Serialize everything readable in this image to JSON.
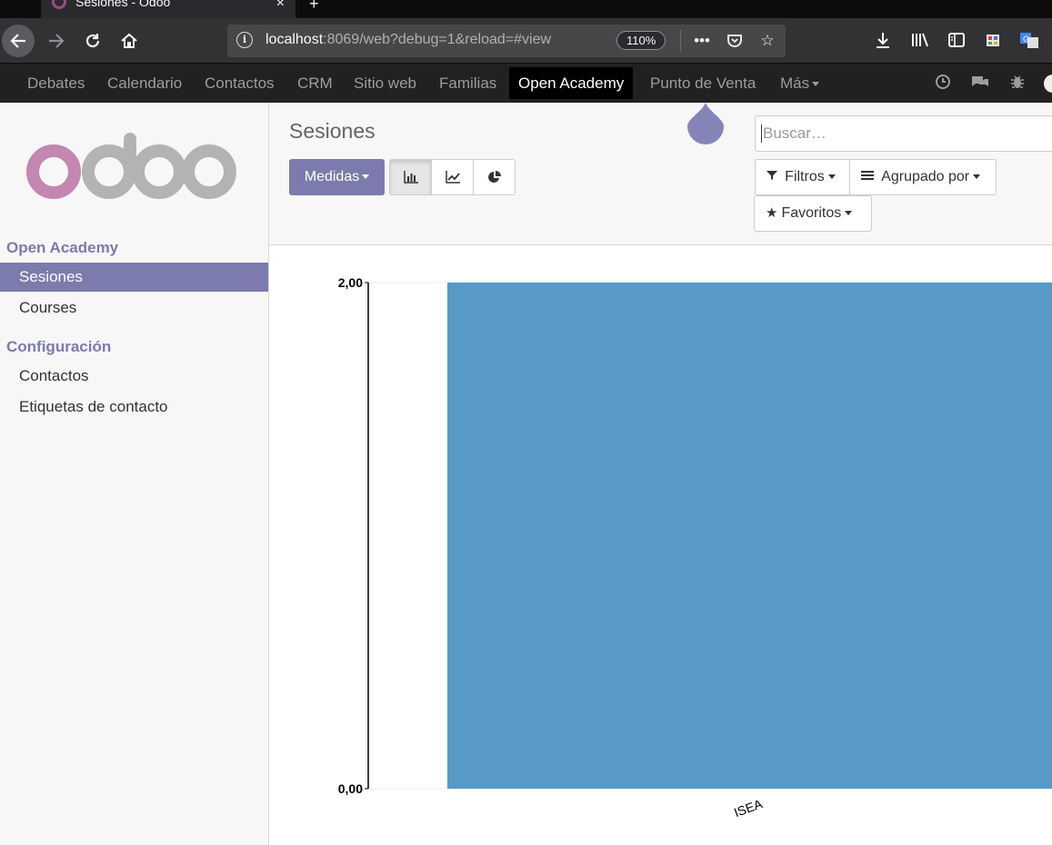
{
  "browser": {
    "tab_title": "Sesiones - Odoo",
    "tab_close": "×",
    "new_tab": "+",
    "url_host": "localhost",
    "url_rest": ":8069/web?debug=1&reload=#view",
    "zoom": "110%"
  },
  "topmenu": {
    "items": [
      "Debates",
      "Calendario",
      "Contactos",
      "CRM",
      "Sitio web",
      "Familias",
      "Open Academy",
      "Punto de Venta",
      "Más"
    ],
    "active": "Open Academy"
  },
  "sidebar": {
    "sections": [
      {
        "title": "Open Academy",
        "items": [
          "Sesiones",
          "Courses"
        ]
      },
      {
        "title": "Configuración",
        "items": [
          "Contactos",
          "Etiquetas de contacto"
        ]
      }
    ],
    "active_item": "Sesiones"
  },
  "control_panel": {
    "title": "Sesiones",
    "measures_label": "Medidas",
    "search_placeholder": "Buscar…",
    "filters_label": "Filtros",
    "groupby_label": "Agrupado por",
    "favorites_label": "Favoritos"
  },
  "colors": {
    "brand": "#7c7bad",
    "bar": "#5799c7",
    "menu_bg": "#212121"
  },
  "chart_data": {
    "type": "bar",
    "categories": [
      "ISEA"
    ],
    "values": [
      2
    ],
    "ylim": [
      0,
      2
    ],
    "yticks": [
      "0,00",
      "2,00"
    ],
    "legend": "none"
  }
}
